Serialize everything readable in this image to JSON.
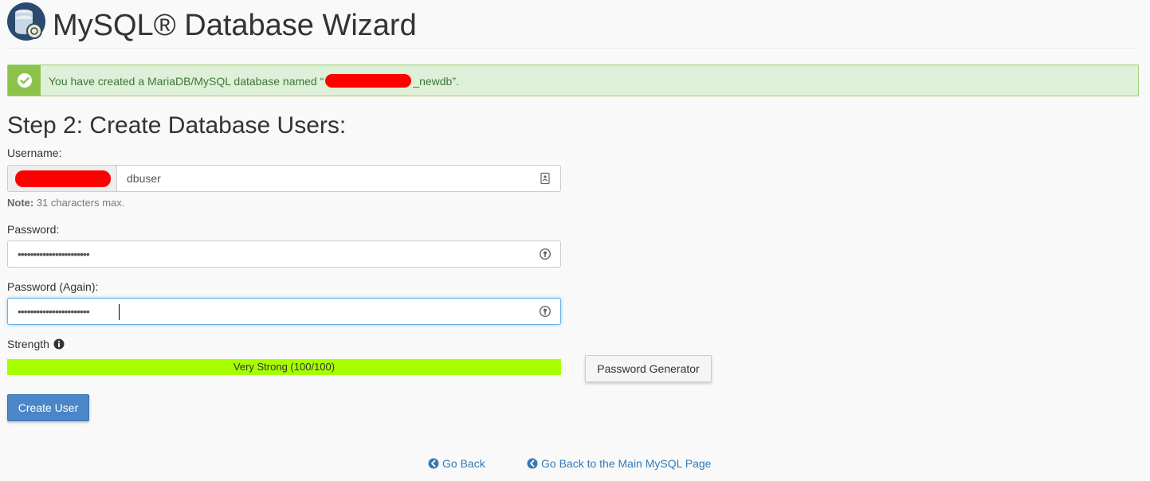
{
  "header": {
    "title": "MySQL® Database Wizard",
    "logo_icon": "database-icon"
  },
  "alert": {
    "icon": "check-circle-icon",
    "text_before": "You have created a MariaDB/MySQL database named “",
    "text_after": "_newdb”.",
    "status_color": "#8bc34a"
  },
  "step": {
    "title": "Step 2: Create Database Users:"
  },
  "form": {
    "username_label": "Username:",
    "username_value": "dbuser",
    "note_label": "Note:",
    "note_text": " 31 characters max.",
    "password_label": "Password:",
    "password_value": "•••••••••••••••••••••••",
    "password_again_label": "Password (Again):",
    "password_again_value": "•••••••••••••••••••••••",
    "strength_label": "Strength",
    "strength_text": "Very Strong (100/100)",
    "strength_value": 100,
    "strength_color": "#a6ff00",
    "password_generator_label": "Password Generator",
    "create_user_label": "Create User"
  },
  "links": {
    "go_back": "Go Back",
    "go_back_main": "Go Back to the Main MySQL Page"
  },
  "colors": {
    "primary": "#4a86c8",
    "link": "#337ab7"
  }
}
